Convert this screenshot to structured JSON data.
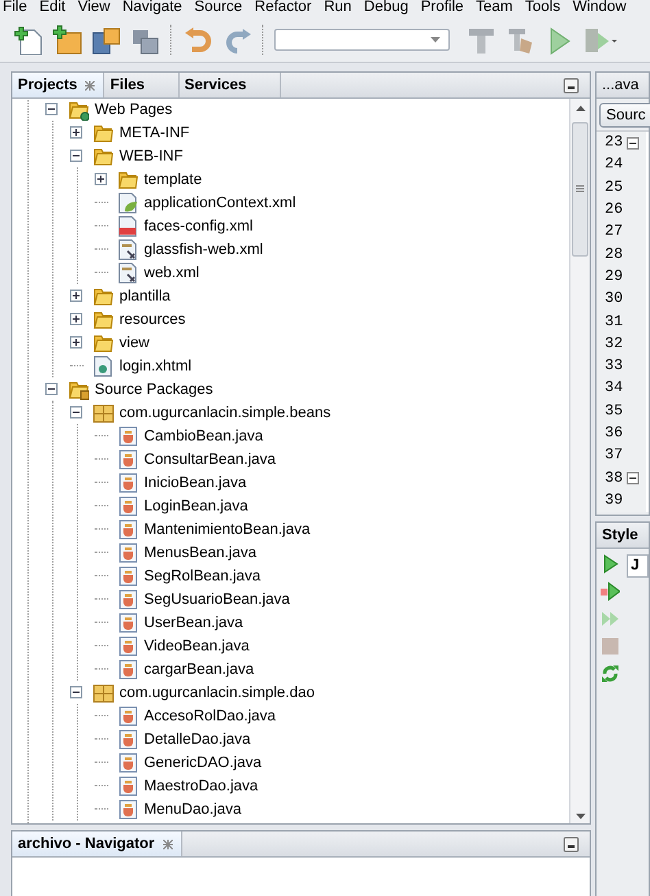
{
  "menu": [
    "File",
    "Edit",
    "View",
    "Navigate",
    "Source",
    "Refactor",
    "Run",
    "Debug",
    "Profile",
    "Team",
    "Tools",
    "Window"
  ],
  "projects_panel": {
    "tabs": [
      {
        "label": "Projects",
        "selected": true
      },
      {
        "label": "Files",
        "selected": false
      },
      {
        "label": "Services",
        "selected": false
      }
    ],
    "tree": [
      {
        "label": "Web Pages",
        "kind": "web-pages",
        "expanded": true,
        "children": [
          {
            "label": "META-INF",
            "kind": "folder",
            "expanded": false
          },
          {
            "label": "WEB-INF",
            "kind": "folder",
            "expanded": true,
            "children": [
              {
                "label": "template",
                "kind": "folder",
                "expanded": false
              },
              {
                "label": "applicationContext.xml",
                "kind": "spring-xml"
              },
              {
                "label": "faces-config.xml",
                "kind": "faces-xml"
              },
              {
                "label": "glassfish-web.xml",
                "kind": "config-xml"
              },
              {
                "label": "web.xml",
                "kind": "config-xml"
              }
            ]
          },
          {
            "label": "plantilla",
            "kind": "folder",
            "expanded": false
          },
          {
            "label": "resources",
            "kind": "folder",
            "expanded": false
          },
          {
            "label": "view",
            "kind": "folder",
            "expanded": false
          },
          {
            "label": "login.xhtml",
            "kind": "xhtml"
          }
        ]
      },
      {
        "label": "Source Packages",
        "kind": "source-packages",
        "expanded": true,
        "children": [
          {
            "label": "com.ugurcanlacin.simple.beans",
            "kind": "package",
            "expanded": true,
            "children": [
              {
                "label": "CambioBean.java",
                "kind": "java"
              },
              {
                "label": "ConsultarBean.java",
                "kind": "java"
              },
              {
                "label": "InicioBean.java",
                "kind": "java"
              },
              {
                "label": "LoginBean.java",
                "kind": "java"
              },
              {
                "label": "MantenimientoBean.java",
                "kind": "java"
              },
              {
                "label": "MenusBean.java",
                "kind": "java"
              },
              {
                "label": "SegRolBean.java",
                "kind": "java"
              },
              {
                "label": "SegUsuarioBean.java",
                "kind": "java"
              },
              {
                "label": "UserBean.java",
                "kind": "java"
              },
              {
                "label": "VideoBean.java",
                "kind": "java"
              },
              {
                "label": "cargarBean.java",
                "kind": "java"
              }
            ]
          },
          {
            "label": "com.ugurcanlacin.simple.dao",
            "kind": "package",
            "expanded": true,
            "children": [
              {
                "label": "AccesoRolDao.java",
                "kind": "java"
              },
              {
                "label": "DetalleDao.java",
                "kind": "java"
              },
              {
                "label": "GenericDAO.java",
                "kind": "java"
              },
              {
                "label": "MaestroDao.java",
                "kind": "java"
              },
              {
                "label": "MenuDao.java",
                "kind": "java"
              }
            ]
          }
        ]
      }
    ]
  },
  "navigator": {
    "title": "archivo - Navigator"
  },
  "editor": {
    "tab": "...ava",
    "source_button": "Sourc",
    "line_numbers": [
      "23",
      "24",
      "25",
      "26",
      "27",
      "28",
      "29",
      "30",
      "31",
      "32",
      "33",
      "34",
      "35",
      "36",
      "37",
      "38",
      "39"
    ]
  },
  "style_panel": {
    "title": "Style",
    "tab": "J"
  }
}
